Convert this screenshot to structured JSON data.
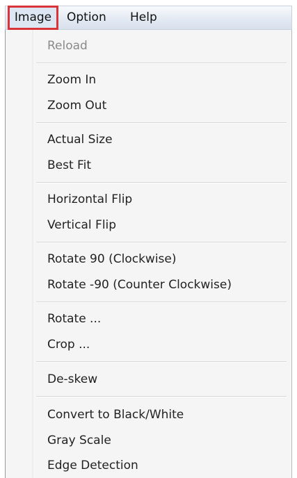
{
  "menubar": {
    "items": [
      {
        "label": "Image"
      },
      {
        "label": "Option"
      },
      {
        "label": "Help"
      }
    ]
  },
  "menu": {
    "items": [
      {
        "label": "Reload",
        "enabled": false
      },
      {
        "label": "Zoom In",
        "enabled": true
      },
      {
        "label": "Zoom Out",
        "enabled": true
      },
      {
        "label": "Actual Size",
        "enabled": true
      },
      {
        "label": "Best Fit",
        "enabled": true
      },
      {
        "label": "Horizontal Flip",
        "enabled": true
      },
      {
        "label": "Vertical Flip",
        "enabled": true
      },
      {
        "label": "Rotate 90 (Clockwise)",
        "enabled": true
      },
      {
        "label": "Rotate -90 (Counter Clockwise)",
        "enabled": true
      },
      {
        "label": "Rotate ...",
        "enabled": true
      },
      {
        "label": "Crop ...",
        "enabled": true
      },
      {
        "label": "De-skew",
        "enabled": true
      },
      {
        "label": "Convert to Black/White",
        "enabled": true
      },
      {
        "label": "Gray Scale",
        "enabled": true
      },
      {
        "label": "Edge Detection",
        "enabled": true
      }
    ]
  },
  "colors": {
    "highlight_border": "#d9343a",
    "disabled_text": "#8a8a8a"
  }
}
